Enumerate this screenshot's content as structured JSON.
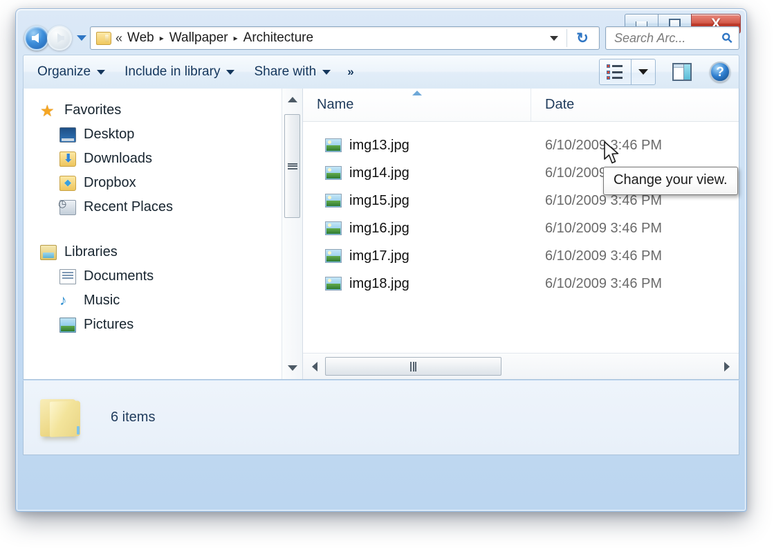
{
  "window": {
    "controls": {
      "minimize_label": "Minimize",
      "maximize_label": "Maximize",
      "close_label": "X"
    }
  },
  "addressbar": {
    "back_label": "Back",
    "forward_label": "Forward",
    "recent_label": "Recent pages",
    "folder_icon": "folder-icon",
    "overflow_marker": "«",
    "crumbs": [
      {
        "label": "Web"
      },
      {
        "label": "Wallpaper"
      },
      {
        "label": "Architecture"
      }
    ],
    "separator": "▸",
    "dropdown_label": "Previous locations",
    "refresh_label": "↻"
  },
  "search": {
    "placeholder": "Search Arc...",
    "icon": "search-icon"
  },
  "toolbar": {
    "items": [
      {
        "label": "Organize",
        "has_caret": true
      },
      {
        "label": "Include in library",
        "has_caret": true
      },
      {
        "label": "Share with",
        "has_caret": true
      }
    ],
    "overflow_label": "»",
    "view_button_label": "Change your view",
    "view_dropdown_label": "More options",
    "preview_pane_label": "Show the preview pane",
    "help_label": "?"
  },
  "tooltip": {
    "text": "Change your view."
  },
  "navpane": {
    "groups": [
      {
        "label": "Favorites",
        "icon": "star-icon",
        "children": [
          {
            "label": "Desktop",
            "icon": "desktop-icon"
          },
          {
            "label": "Downloads",
            "icon": "downloads-folder-icon"
          },
          {
            "label": "Dropbox",
            "icon": "dropbox-folder-icon"
          },
          {
            "label": "Recent Places",
            "icon": "recent-places-icon"
          }
        ]
      },
      {
        "label": "Libraries",
        "icon": "libraries-icon",
        "children": [
          {
            "label": "Documents",
            "icon": "documents-icon"
          },
          {
            "label": "Music",
            "icon": "music-icon"
          },
          {
            "label": "Pictures",
            "icon": "pictures-icon"
          }
        ]
      }
    ]
  },
  "filelist": {
    "columns": [
      {
        "label": "Name",
        "sorted": "ascending"
      },
      {
        "label": "Date"
      }
    ],
    "rows": [
      {
        "name": "img13.jpg",
        "date": "6/10/2009 3:46 PM",
        "icon": "jpg-image-icon"
      },
      {
        "name": "img14.jpg",
        "date": "6/10/2009 3:46 PM",
        "icon": "jpg-image-icon"
      },
      {
        "name": "img15.jpg",
        "date": "6/10/2009 3:46 PM",
        "icon": "jpg-image-icon"
      },
      {
        "name": "img16.jpg",
        "date": "6/10/2009 3:46 PM",
        "icon": "jpg-image-icon"
      },
      {
        "name": "img17.jpg",
        "date": "6/10/2009 3:46 PM",
        "icon": "jpg-image-icon"
      },
      {
        "name": "img18.jpg",
        "date": "6/10/2009 3:46 PM",
        "icon": "jpg-image-icon"
      }
    ]
  },
  "statusbar": {
    "item_count_text": "6 items",
    "folder_icon": "large-folder-icon"
  },
  "colors": {
    "window_chrome": "#cfe2f5",
    "close_button": "#b93525",
    "accent_blue": "#2f76c4",
    "text_dark": "#1f3b5c",
    "date_gray": "#6b6b6b"
  }
}
